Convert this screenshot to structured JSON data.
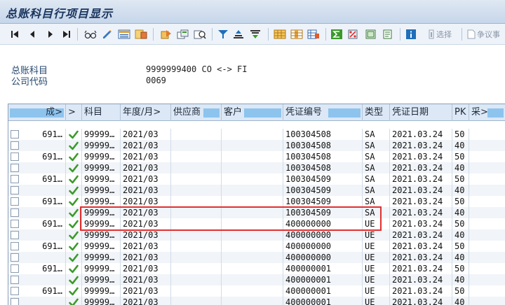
{
  "window": {
    "title": "总账科目行项目显示"
  },
  "toolbar": {
    "items": [
      {
        "name": "first-page-icon"
      },
      {
        "name": "previous-page-icon"
      },
      {
        "name": "next-page-icon"
      },
      {
        "name": "last-page-icon"
      },
      {
        "name": "glasses-icon"
      },
      {
        "name": "pencil-icon"
      },
      {
        "name": "layout-icon"
      },
      {
        "name": "sort-icon"
      },
      {
        "name": "document-icon"
      },
      {
        "name": "copy-icon"
      },
      {
        "name": "search-icon"
      },
      {
        "name": "filter-icon"
      },
      {
        "name": "sort-ascending-icon"
      },
      {
        "name": "sort-descending-icon"
      },
      {
        "name": "grid-icon"
      },
      {
        "name": "columns-icon"
      },
      {
        "name": "add-column-icon"
      },
      {
        "name": "sum-icon"
      },
      {
        "name": "percent-icon"
      },
      {
        "name": "export-icon"
      },
      {
        "name": "print-icon"
      },
      {
        "name": "info-icon"
      }
    ],
    "select_label": "选择",
    "dispute_label": "争议事",
    "accent": "#1f6fba"
  },
  "header": {
    "account_label": "总账科目",
    "account_value": "9999999400  CO <-> FI",
    "company_label": "公司代码",
    "company_value": "0069"
  },
  "table": {
    "columns": [
      "成>",
      ">",
      "科目",
      "年度/月>",
      "供应商",
      "客户",
      "凭证编号",
      "类型",
      "凭证日期",
      "PK",
      "采>"
    ],
    "rows": [
      {
        "amount": "691…",
        "account": "99999…",
        "period": "2021/03",
        "doc": "100304508",
        "type": "SA",
        "date": "2021.03.24",
        "pk": "50"
      },
      {
        "amount": "",
        "account": "99999…",
        "period": "2021/03",
        "doc": "100304508",
        "type": "SA",
        "date": "2021.03.24",
        "pk": "40"
      },
      {
        "amount": "691…",
        "account": "99999…",
        "period": "2021/03",
        "doc": "100304508",
        "type": "SA",
        "date": "2021.03.24",
        "pk": "50"
      },
      {
        "amount": "",
        "account": "99999…",
        "period": "2021/03",
        "doc": "100304508",
        "type": "SA",
        "date": "2021.03.24",
        "pk": "40"
      },
      {
        "amount": "691…",
        "account": "99999…",
        "period": "2021/03",
        "doc": "100304509",
        "type": "SA",
        "date": "2021.03.24",
        "pk": "50"
      },
      {
        "amount": "",
        "account": "99999…",
        "period": "2021/03",
        "doc": "100304509",
        "type": "SA",
        "date": "2021.03.24",
        "pk": "40"
      },
      {
        "amount": "691…",
        "account": "99999…",
        "period": "2021/03",
        "doc": "100304509",
        "type": "SA",
        "date": "2021.03.24",
        "pk": "50"
      },
      {
        "amount": "",
        "account": "99999…",
        "period": "2021/03",
        "doc": "100304509",
        "type": "SA",
        "date": "2021.03.24",
        "pk": "40"
      },
      {
        "amount": "691…",
        "account": "99999…",
        "period": "2021/03",
        "doc": "400000000",
        "type": "UE",
        "date": "2021.03.24",
        "pk": "50"
      },
      {
        "amount": "",
        "account": "99999…",
        "period": "2021/03",
        "doc": "400000000",
        "type": "UE",
        "date": "2021.03.24",
        "pk": "40"
      },
      {
        "amount": "691…",
        "account": "99999…",
        "period": "2021/03",
        "doc": "400000000",
        "type": "UE",
        "date": "2021.03.24",
        "pk": "50"
      },
      {
        "amount": "",
        "account": "99999…",
        "period": "2021/03",
        "doc": "400000000",
        "type": "UE",
        "date": "2021.03.24",
        "pk": "40"
      },
      {
        "amount": "691…",
        "account": "99999…",
        "period": "2021/03",
        "doc": "400000001",
        "type": "UE",
        "date": "2021.03.24",
        "pk": "50"
      },
      {
        "amount": "",
        "account": "99999…",
        "period": "2021/03",
        "doc": "400000001",
        "type": "UE",
        "date": "2021.03.24",
        "pk": "40"
      },
      {
        "amount": "691…",
        "account": "99999…",
        "period": "2021/03",
        "doc": "400000001",
        "type": "UE",
        "date": "2021.03.24",
        "pk": "50"
      },
      {
        "amount": "",
        "account": "99999…",
        "period": "2021/03",
        "doc": "400000001",
        "type": "UE",
        "date": "2021.03.24",
        "pk": "40"
      }
    ],
    "status_icon": "green-check-icon",
    "colors": {
      "header_bar": "#8dc4ee",
      "check": "#3a9a2a",
      "highlight": "#e03030"
    }
  }
}
